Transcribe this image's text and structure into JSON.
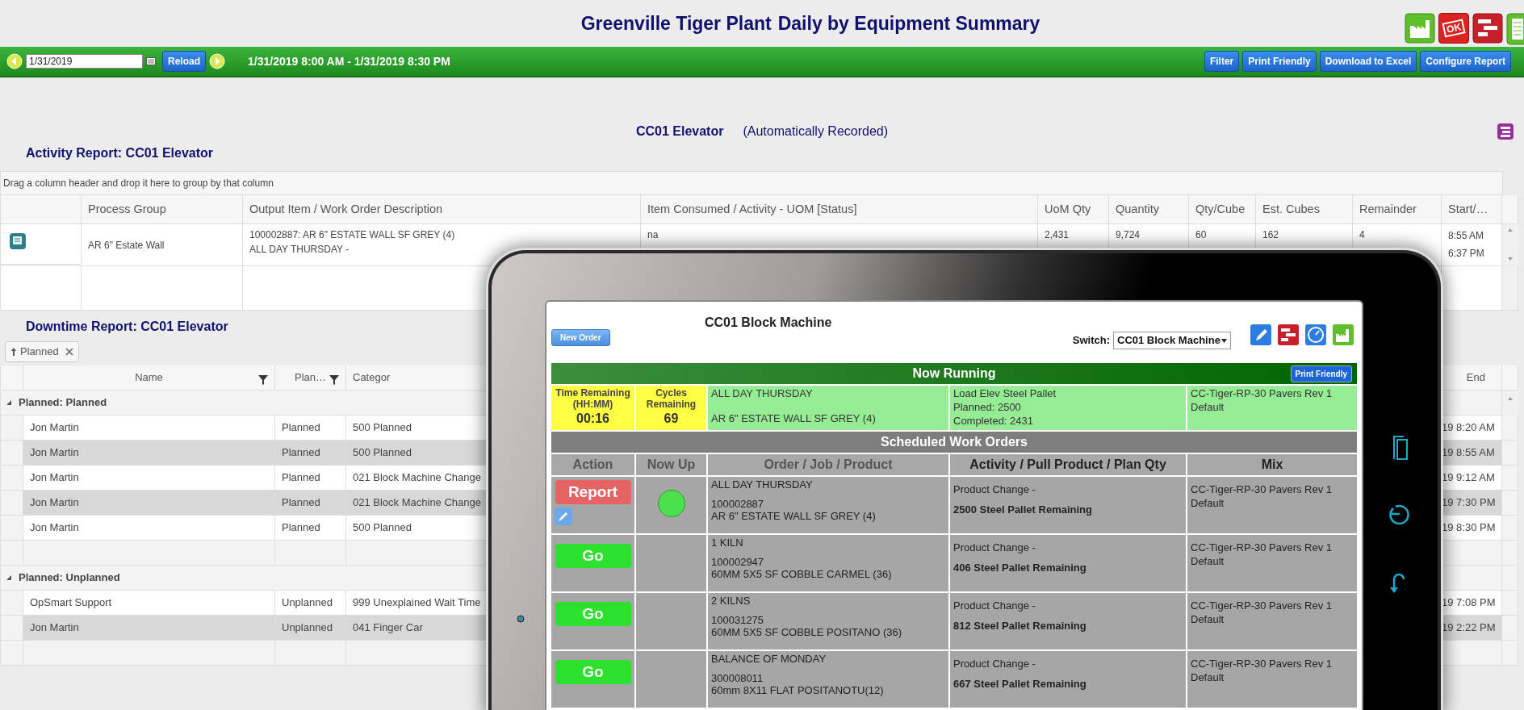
{
  "header": {
    "title": "Greenville Tiger Plant",
    "subtitle": "Daily by Equipment Summary",
    "badge_text": "OK"
  },
  "toolbar": {
    "date": "1/31/2019",
    "reload": "Reload",
    "range": "1/31/2019 8:00 AM - 1/31/2019 8:30 PM",
    "buttons": [
      "Filter",
      "Print Friendly",
      "Download to Excel",
      "Configure Report"
    ]
  },
  "equipment": {
    "name": "CC01 Elevator",
    "mode": "(Automatically Recorded)"
  },
  "activity_report": {
    "title": "Activity Report: CC01 Elevator",
    "group_hint": "Drag a column header and drop it here to group by that column",
    "columns": [
      "Process Group",
      "Output Item / Work Order Description",
      "Item Consumed / Activity - UOM [Status]",
      "UoM Qty",
      "Quantity",
      "Qty/Cube",
      "Est. Cubes",
      "Remainder",
      "Start/…"
    ],
    "rows": [
      {
        "process_group": "AR 6\" Estate Wall",
        "output": [
          "100002887: AR 6\" ESTATE WALL SF GREY (4)",
          "ALL DAY THURSDAY -"
        ],
        "consumed": "na",
        "uom_qty": "2,431",
        "quantity": "9,724",
        "qty_cube": "60",
        "est_cubes": "162",
        "remainder": "4",
        "start": [
          "8:55 AM",
          "6:37 PM"
        ]
      }
    ]
  },
  "downtime_report": {
    "title": "Downtime Report: CC01 Elevator",
    "group_chip": "Planned",
    "columns": [
      "Name",
      "Plan…",
      "Categor",
      "End"
    ],
    "groups": [
      {
        "label": "Planned: Planned",
        "expanded": true,
        "rows": [
          {
            "name": "Jon Martin",
            "planned": "Planned",
            "category": "500 Planned",
            "end": "19 8:20 AM"
          },
          {
            "name": "Jon Martin",
            "planned": "Planned",
            "category": "500 Planned",
            "end": "19 8:55 AM"
          },
          {
            "name": "Jon Martin",
            "planned": "Planned",
            "category": "021 Block Machine Change",
            "end": "19 9:12 AM"
          },
          {
            "name": "Jon Martin",
            "planned": "Planned",
            "category": "021 Block Machine Change",
            "end": "19 7:30 PM"
          },
          {
            "name": "Jon Martin",
            "planned": "Planned",
            "category": "500 Planned",
            "end": "19 8:30 PM"
          }
        ]
      },
      {
        "label": "Planned: Unplanned",
        "expanded": true,
        "rows": [
          {
            "name": "OpSmart Support",
            "planned": "Unplanned",
            "category": "999 Unexplained Wait Time",
            "end": "19 7:08 PM"
          },
          {
            "name": "Jon Martin",
            "planned": "Unplanned",
            "category": "041 Finger Car",
            "end": "19 2:22 PM"
          }
        ]
      }
    ]
  },
  "tablet": {
    "new_order": "New Order",
    "title": "CC01 Block Machine",
    "switch_label": "Switch:",
    "switch_value": "CC01 Block Machine",
    "now_running": {
      "title": "Now Running",
      "print": "Print Friendly",
      "time_label": "Time Remaining (HH:MM)",
      "time": "00:16",
      "cycles_label": "Cycles Remaining",
      "cycles": "69",
      "order": [
        "ALL DAY THURSDAY",
        "AR 6\" ESTATE WALL SF GREY (4)"
      ],
      "activity": [
        "Load Elev Steel Pallet",
        "Planned: 2500",
        "Completed: 2431"
      ],
      "mix": [
        "CC-Tiger-RP-30 Pavers Rev 1",
        "Default"
      ]
    },
    "scheduled": {
      "title": "Scheduled Work Orders",
      "columns": [
        "Action",
        "Now Up",
        "Order / Job / Product",
        "Activity / Pull Product / Plan Qty",
        "Mix"
      ],
      "rows": [
        {
          "kind": "report",
          "action": "Report",
          "editable": true,
          "now_up": true,
          "order": [
            "ALL DAY THURSDAY",
            "100002887",
            "AR 6\" ESTATE WALL SF GREY (4)"
          ],
          "activity": "Product Change -",
          "remaining": "2500 Steel Pallet Remaining",
          "mix": [
            "CC-Tiger-RP-30 Pavers Rev 1",
            "Default"
          ]
        },
        {
          "kind": "go",
          "action": "Go",
          "editable": false,
          "now_up": false,
          "order": [
            "1 KILN",
            "100002947",
            "60MM 5X5 SF COBBLE CARMEL (36)"
          ],
          "activity": "Product Change -",
          "remaining": "406 Steel Pallet Remaining",
          "mix": [
            "CC-Tiger-RP-30 Pavers Rev 1",
            "Default"
          ]
        },
        {
          "kind": "go",
          "action": "Go",
          "editable": false,
          "now_up": false,
          "order": [
            "2 KILNS",
            "100031275",
            "60MM 5X5 SF COBBLE POSITANO (36)"
          ],
          "activity": "Product Change -",
          "remaining": "812 Steel Pallet Remaining",
          "mix": [
            "CC-Tiger-RP-30 Pavers Rev 1",
            "Default"
          ]
        },
        {
          "kind": "go",
          "action": "Go",
          "editable": false,
          "now_up": false,
          "order": [
            "BALANCE OF MONDAY",
            "300008011",
            "60mm 8X11 FLAT POSITANOTU(12)"
          ],
          "activity": "Product Change -",
          "remaining": "667 Steel Pallet Remaining",
          "mix": [
            "CC-Tiger-RP-30 Pavers Rev 1",
            "Default"
          ]
        }
      ]
    }
  }
}
